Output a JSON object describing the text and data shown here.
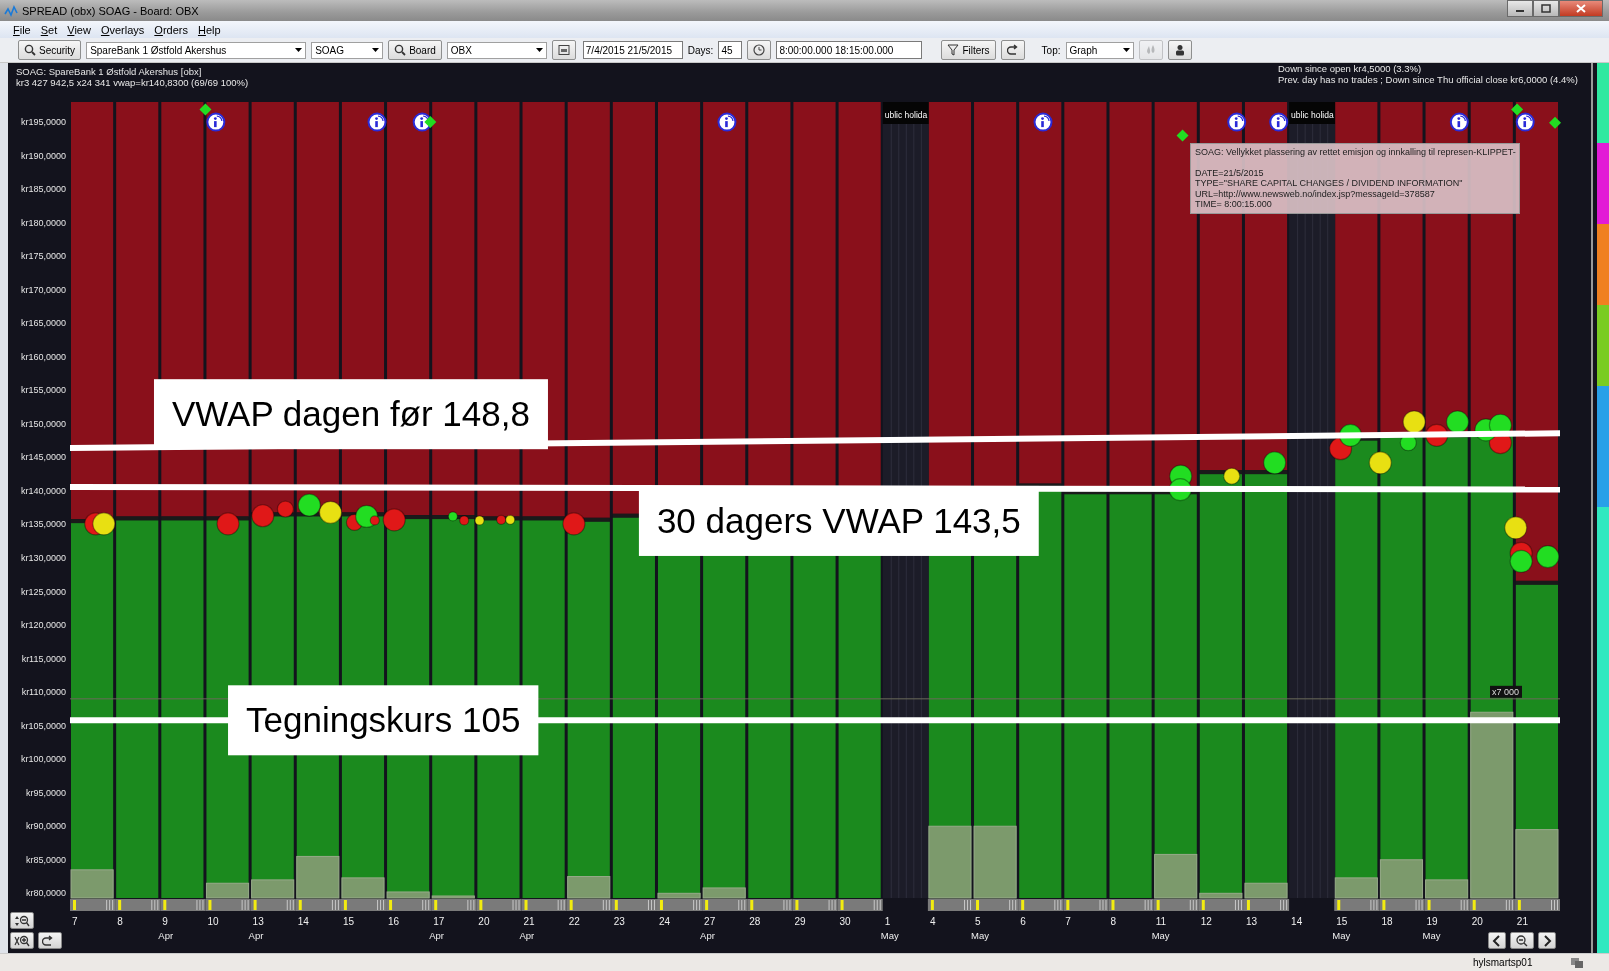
{
  "window": {
    "title": "SPREAD (obx) SOAG - Board: OBX"
  },
  "menu": [
    "File",
    "Set",
    "View",
    "Overlays",
    "Orders",
    "Help"
  ],
  "toolbar": [
    {
      "kind": "search",
      "label": "Security"
    },
    {
      "kind": "dropdown",
      "value": "SpareBank 1 Østfold Akershus"
    },
    {
      "kind": "dropdown",
      "value": "SOAG"
    },
    {
      "kind": "search",
      "label": "Board"
    },
    {
      "kind": "dropdown",
      "value": "OBX"
    },
    {
      "kind": "calendar",
      "disabled": false
    },
    {
      "kind": "field",
      "value": "7/4/2015 21/5/2015"
    },
    {
      "kind": "label",
      "text": "Days:"
    },
    {
      "kind": "field",
      "value": "45"
    },
    {
      "kind": "clock",
      "disabled": false
    },
    {
      "kind": "field",
      "value": "8:00:00.000 18:15:00.000"
    },
    {
      "kind": "filter",
      "label": "Filters"
    },
    {
      "kind": "undo",
      "disabled": false
    },
    {
      "kind": "label",
      "text": "Top:"
    },
    {
      "kind": "dropdown",
      "value": "Graph"
    },
    {
      "kind": "drops",
      "disabled": true
    },
    {
      "kind": "person",
      "disabled": false
    }
  ],
  "chart": {
    "info_left": [
      "SOAG: SpareBank 1 Østfold Akershus [obx]",
      "kr3 427 942,5   x24 341   vwap=kr140,8300   (69/69 100%)"
    ],
    "info_right": [
      "Down since open kr4,5000 (3.3%)",
      "Prev. day has no trades ; Down since Thu official close kr6,0000 (4.4%)"
    ],
    "tooltip": {
      "title": "SOAG: Vellykket plassering av rettet emisjon og innkalling til represen-KLIPPET-",
      "details": [
        "DATE=21/5/2015",
        "TYPE=\"SHARE CAPITAL CHANGES / DIVIDEND INFORMATION\"",
        "URL=http://www.newsweb.no/index.jsp?messageId=378587",
        "TIME= 8:00:15.000"
      ]
    },
    "holiday_labels": [
      "ublic holida",
      "ublic holida"
    ],
    "scale_label": "x7 000",
    "y_axis_labels": [
      "kr195,0000",
      "kr190,0000",
      "kr185,0000",
      "kr180,0000",
      "kr175,0000",
      "kr170,0000",
      "kr165,0000",
      "kr160,0000",
      "kr155,0000",
      "kr150,0000",
      "kr145,0000",
      "kr140,0000",
      "kr135,0000",
      "kr130,0000",
      "kr125,0000",
      "kr120,0000",
      "kr115,0000",
      "kr110,0000",
      "kr105,0000",
      "kr100,0000",
      "kr95,0000",
      "kr90,0000",
      "kr85,0000",
      "kr80,0000"
    ],
    "x_axis_labels": [
      "7",
      "8",
      "9 Apr",
      "10",
      "13 Apr",
      "14",
      "15",
      "16",
      "17 Apr",
      "20",
      "21 Apr",
      "22",
      "23",
      "24",
      "27 Apr",
      "28",
      "29",
      "30",
      "1 May",
      "4",
      "5 May",
      "6",
      "7",
      "8",
      "11 May",
      "12",
      "13",
      "14",
      "15 May",
      "18",
      "19 May",
      "20",
      "21"
    ],
    "reference_labels": [
      "VWAP dagen før 148,8",
      "30 dagers VWAP 143,5",
      "Tegningskurs 105"
    ]
  },
  "status_bar": {
    "text": "hylsmartsp01"
  }
}
